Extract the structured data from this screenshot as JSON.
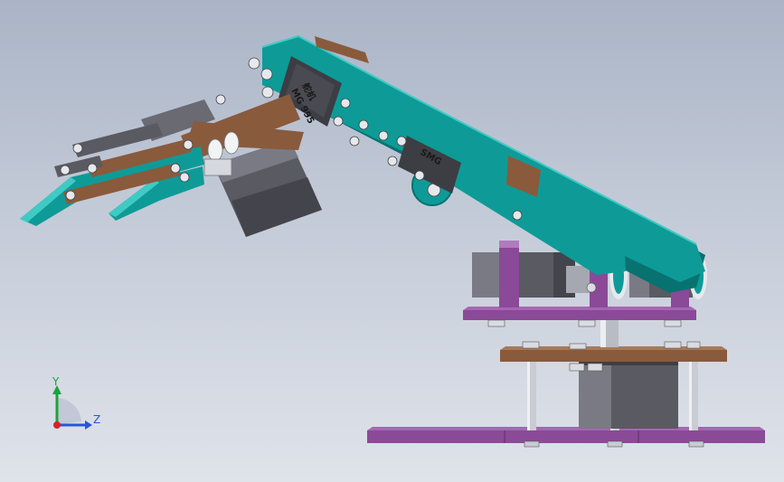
{
  "viewport": {
    "background_top": "#aab4c6",
    "background_bottom": "#dfe3ea"
  },
  "colors": {
    "arm_teal": "#0e9b98",
    "arm_teal_dark": "#087270",
    "base_plate": "#8a4a97",
    "mid_plate": "#8a5a3c",
    "servo_body": "#5a5a62",
    "standoff": "#c9ccd3",
    "bolt": "#d9dce2"
  },
  "servos": {
    "wrist_label_top": "舵机",
    "wrist_label_bottom": "MG 995",
    "forearm_label": "SMG"
  },
  "triad": {
    "y_label": "Y",
    "z_label": "Z",
    "y_color": "#1aa33a",
    "z_color": "#2a55d6",
    "x_color": "#d4232a"
  }
}
